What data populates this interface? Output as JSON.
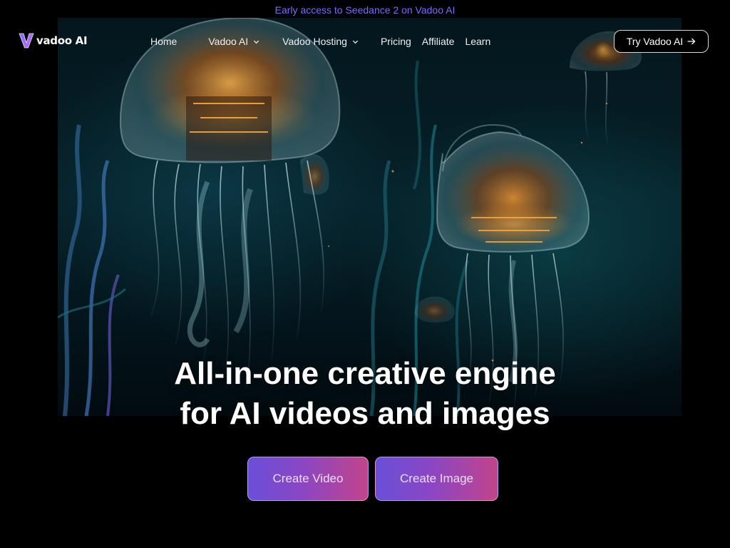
{
  "announcement": {
    "text": "Early access to Seedance 2 on Vadoo AI",
    "color": "#7b6bff"
  },
  "header": {
    "logo_text": "vadoo AI",
    "logo_icon": "v-logo-icon",
    "nav": [
      {
        "label": "Home",
        "has_dropdown": false
      },
      {
        "label": "Vadoo AI",
        "has_dropdown": true
      },
      {
        "label": "Vadoo Hosting",
        "has_dropdown": true
      },
      {
        "label": "Pricing",
        "has_dropdown": false
      },
      {
        "label": "Affiliate",
        "has_dropdown": false
      },
      {
        "label": "Learn",
        "has_dropdown": false
      }
    ],
    "cta_label": "Try Vadoo AI",
    "cta_icon": "arrow-right-icon"
  },
  "hero": {
    "image_subject": "glowing mechanical jellyfish underwater",
    "headline_line1": "All-in-one creative engine",
    "headline_line2": "for AI videos and images",
    "buttons": [
      {
        "label": "Create Video"
      },
      {
        "label": "Create Image"
      }
    ],
    "button_gradient": [
      "#6a4fd8",
      "#8a46c4",
      "#c2448a"
    ]
  }
}
